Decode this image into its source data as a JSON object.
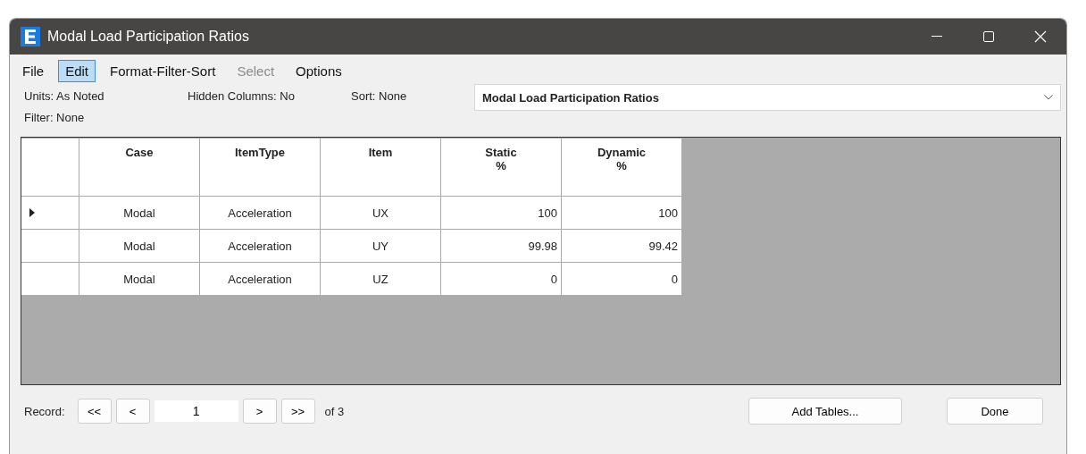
{
  "window": {
    "title": "Modal Load Participation Ratios"
  },
  "menu": [
    {
      "label": "File",
      "selected": false,
      "disabled": false
    },
    {
      "label": "Edit",
      "selected": true,
      "disabled": false
    },
    {
      "label": "Format-Filter-Sort",
      "selected": false,
      "disabled": false
    },
    {
      "label": "Select",
      "selected": false,
      "disabled": true
    },
    {
      "label": "Options",
      "selected": false,
      "disabled": false
    }
  ],
  "info": {
    "units": "Units:  As Noted",
    "hidden_columns": "Hidden Columns:  No",
    "sort": "Sort:  None",
    "filter": "Filter:  None"
  },
  "table_select": {
    "value": "Modal Load Participation Ratios"
  },
  "table": {
    "columns": [
      {
        "label": "Case",
        "kind": "text"
      },
      {
        "label": "ItemType",
        "kind": "text"
      },
      {
        "label": "Item",
        "kind": "text"
      },
      {
        "label": "Static",
        "unit": "%",
        "kind": "number"
      },
      {
        "label": "Dynamic",
        "unit": "%",
        "kind": "number"
      }
    ],
    "rows": [
      {
        "current": true,
        "cells": [
          "Modal",
          "Acceleration",
          "UX",
          "100",
          "100"
        ]
      },
      {
        "current": false,
        "cells": [
          "Modal",
          "Acceleration",
          "UY",
          "99.98",
          "99.42"
        ]
      },
      {
        "current": false,
        "cells": [
          "Modal",
          "Acceleration",
          "UZ",
          "0",
          "0"
        ]
      }
    ]
  },
  "footer": {
    "record_label": "Record:",
    "first": "<<",
    "prev": "<",
    "record": "1",
    "next": ">",
    "last": ">>",
    "of": "of 3",
    "add_tables": "Add Tables...",
    "done": "Done"
  }
}
